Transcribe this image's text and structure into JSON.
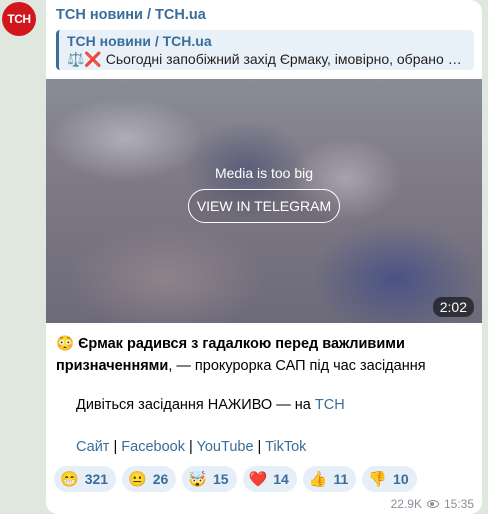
{
  "avatar": {
    "text": "ТСН"
  },
  "channel": {
    "name": "ТСН новини / TCH.ua"
  },
  "reply": {
    "title": "ТСН новини / TCH.ua",
    "text": "⚖️❌ Сьогодні запобіжний захід Єрмаку, імовірно, обрано не буде: суддя ВАКС не встигає"
  },
  "media": {
    "notice": "Media is too big",
    "button": "VIEW IN TELEGRAM",
    "duration": "2:02"
  },
  "message": {
    "emoji": "😳",
    "bold": "Єрмак радився з гадалкою перед важливими призначеннями",
    "rest": ", — прокурорка САП під час засідання",
    "watch_prefix": "Дивіться засідання НАЖИВО — на ",
    "watch_link": "ТСН",
    "links": [
      "Сайт",
      "Facebook",
      "YouTube",
      "TikTok"
    ],
    "separator": " | "
  },
  "reactions": [
    {
      "emoji": "😁",
      "count": "321"
    },
    {
      "emoji": "😐",
      "count": "26"
    },
    {
      "emoji": "🤯",
      "count": "15"
    },
    {
      "emoji": "❤️",
      "count": "14"
    },
    {
      "emoji": "👍",
      "count": "11"
    },
    {
      "emoji": "👎",
      "count": "10"
    }
  ],
  "meta": {
    "views": "22.9K",
    "time": "15:35"
  },
  "colors": {
    "accent": "#3a6d99",
    "avatar_bg": "#d2161e",
    "chat_bg": "#dfe7df"
  }
}
